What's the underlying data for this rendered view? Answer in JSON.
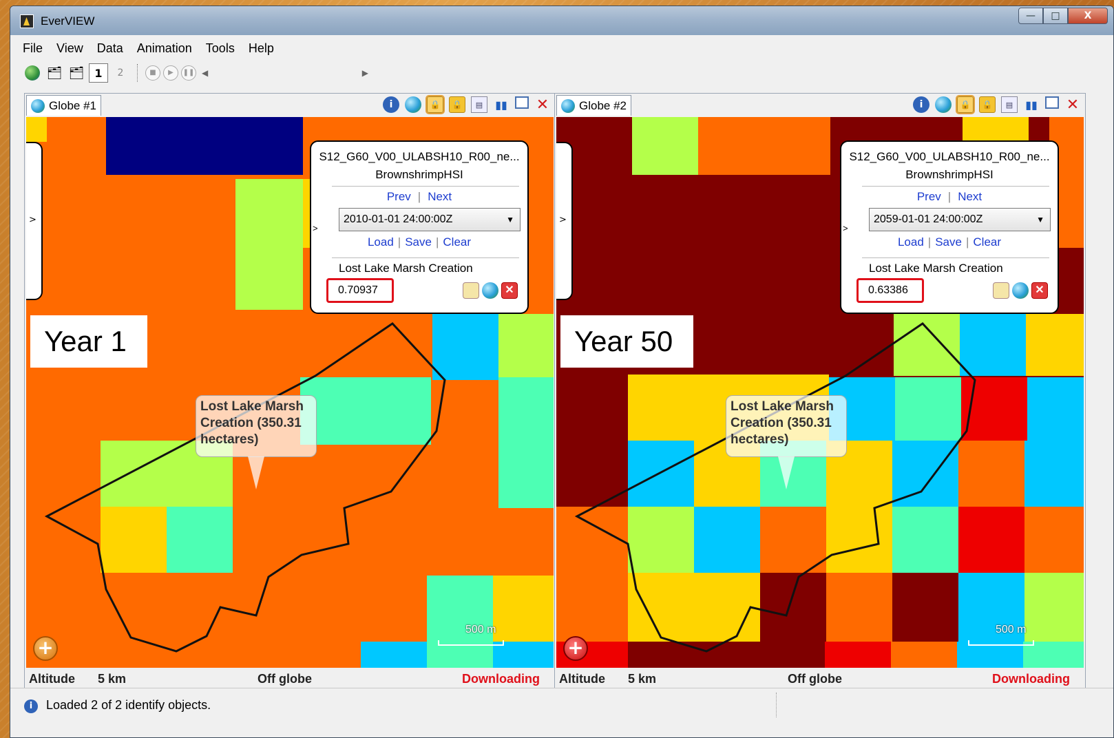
{
  "window": {
    "title": "EverVIEW",
    "controls": {
      "minimize": "—",
      "maximize": "□",
      "close": "X"
    }
  },
  "menu": [
    "File",
    "View",
    "Data",
    "Animation",
    "Tools",
    "Help"
  ],
  "toolbar": {
    "icons": [
      "add-globe-icon",
      "open-layer-icon",
      "add-layer-icon",
      "single-view-icon",
      "dual-view-icon"
    ],
    "playback": [
      "stop-icon",
      "play-icon",
      "pause-icon"
    ],
    "scroll_left": "◀",
    "scroll_right": "▶"
  },
  "panels": [
    {
      "tab_label": "Globe #1",
      "popup": {
        "dataset": "S12_G60_V00_ULABSH10_R00_ne...",
        "variable": "BrownshrimpHSI",
        "prev": "Prev",
        "next": "Next",
        "time_value": "2010-01-01 24:00:00Z",
        "load": "Load",
        "save": "Save",
        "clear": "Clear",
        "feature": "Lost Lake Marsh Creation",
        "value": "0.70937"
      },
      "year_label": "Year 1",
      "balloon": "Lost Lake Marsh Creation (350.31 hectares)",
      "scale": "500 m",
      "status": {
        "altitude_label": "Altitude",
        "altitude_value": "5 km",
        "position": "Off globe",
        "download": "Downloading"
      }
    },
    {
      "tab_label": "Globe #2",
      "popup": {
        "dataset": "S12_G60_V00_ULABSH10_R00_ne...",
        "variable": "BrownshrimpHSI",
        "prev": "Prev",
        "next": "Next",
        "time_value": "2059-01-01 24:00:00Z",
        "load": "Load",
        "save": "Save",
        "clear": "Clear",
        "feature": "Lost Lake Marsh Creation",
        "value": "0.63386"
      },
      "year_label": "Year 50",
      "balloon": "Lost Lake Marsh Creation (350.31 hectares)",
      "scale": "500 m",
      "status": {
        "altitude_label": "Altitude",
        "altitude_value": "5 km",
        "position": "Off globe",
        "download": "Downloading"
      }
    }
  ],
  "statusbar": {
    "text": "Loaded 2 of 2 identify objects."
  },
  "colors": {
    "orange": "#ff6a00",
    "darkred": "#7f0000",
    "red": "#ee0000",
    "yellow": "#ffd500",
    "lime": "#b4ff4a",
    "aqua": "#4dffb4",
    "cyan": "#00c8ff",
    "navy": "#000080",
    "download_red": "#e0101a"
  }
}
